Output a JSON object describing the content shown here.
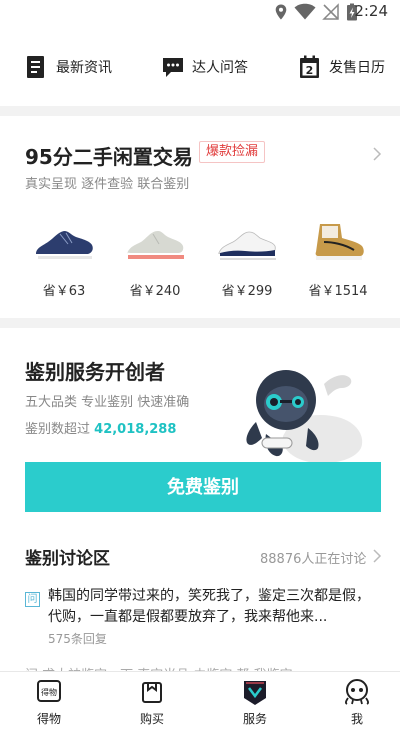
{
  "status_bar": {
    "time": "2:24",
    "icons": [
      "location-icon",
      "wifi-icon",
      "no-signal-icon",
      "battery-charging-icon"
    ]
  },
  "quick_nav": [
    {
      "label": "最新资讯",
      "icon": "news-icon"
    },
    {
      "label": "达人问答",
      "icon": "chat-icon"
    },
    {
      "label": "发售日历",
      "icon": "calendar-icon",
      "calendar_day": "2"
    }
  ],
  "trade": {
    "title": "95分二手闲置交易",
    "badge": "爆款捡漏",
    "subtitle": "真实呈现 逐件查验 联合鉴别",
    "items": [
      {
        "save_label": "省￥63",
        "icon": "navy-running-shoe"
      },
      {
        "save_label": "省￥240",
        "icon": "grey-running-shoe"
      },
      {
        "save_label": "省￥299",
        "icon": "white-navy-basketball-shoe"
      },
      {
        "save_label": "省￥1514",
        "icon": "wheat-high-top-shoe"
      }
    ]
  },
  "appraisal": {
    "title": "鉴别服务开创者",
    "subtitle": "五大品类 专业鉴别 快速准确",
    "count_prefix": "鉴别数超过",
    "count_value": "42,018,288",
    "button_label": "免费鉴别",
    "accent_color": "#2bcccc"
  },
  "discussion": {
    "title": "鉴别讨论区",
    "online_text": "88876人正在讨论",
    "post_tag": "问",
    "post_text": "韩国的同学带过来的，笑死我了，鉴定三次都是假，代购，一直都是假都要放弃了，我来帮他来...",
    "post_replies": "575条回复",
    "next_post_partial": "问 求大神鉴定一下 真定当品 由鉴定 帮 我鉴定"
  },
  "tab_bar": [
    {
      "label": "得物",
      "icon": "dewu-logo-icon"
    },
    {
      "label": "购买",
      "icon": "shopping-bag-icon"
    },
    {
      "label": "服务",
      "icon": "service-shield-icon",
      "active": true
    },
    {
      "label": "我",
      "icon": "profile-mascot-icon"
    }
  ]
}
